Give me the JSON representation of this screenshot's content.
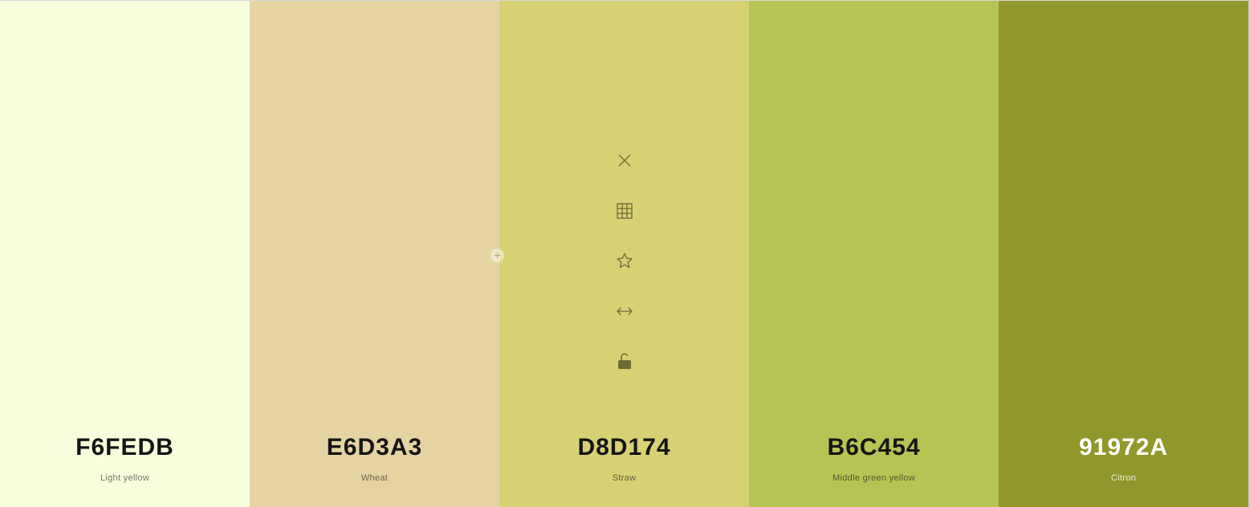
{
  "palette": {
    "colors": [
      {
        "hex": "F6FEDB",
        "name": "Light yellow",
        "color": "#F6FEDB",
        "text_color": "#151515"
      },
      {
        "hex": "E6D3A3",
        "name": "Wheat",
        "color": "#E6D3A3",
        "text_color": "#151515"
      },
      {
        "hex": "D8D174",
        "name": "Straw",
        "color": "#D8D174",
        "text_color": "#151515"
      },
      {
        "hex": "B6C454",
        "name": "Middle green yellow",
        "color": "#B6C454",
        "text_color": "#151515"
      },
      {
        "hex": "91972A",
        "name": "Citron",
        "color": "#91972A",
        "text_color": "#ffffff"
      }
    ],
    "hover_tools": [
      "close-icon",
      "grid-icon",
      "star-icon",
      "drag-arrows-icon",
      "unlock-icon"
    ],
    "tool_color": "#6e6a34"
  }
}
